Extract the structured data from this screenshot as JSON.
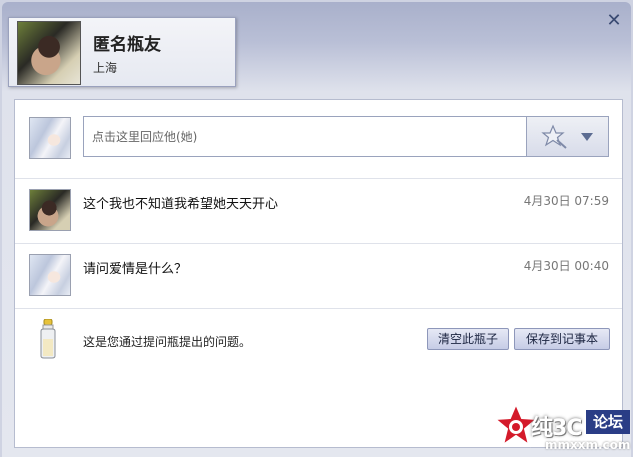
{
  "header": {
    "name": "匿名瓶友",
    "location": "上海",
    "close_icon": "✕"
  },
  "reply": {
    "placeholder": "点击这里回应他(她)",
    "emoji_icon": "magic-star-icon",
    "dropdown_icon": "caret-down-icon"
  },
  "messages": [
    {
      "text": "这个我也不知道我希望她天天开心",
      "time": "4月30日 07:59",
      "avatar": "photo"
    },
    {
      "text": "请问爱情是什么？",
      "time": "4月30日 00:40",
      "avatar": "anime"
    }
  ],
  "footer": {
    "note": "这是您通过提问瓶提出的问题。",
    "clear_button": "清空此瓶子",
    "save_button": "保存到记事本"
  },
  "watermark": {
    "text": "纯3C",
    "badge": "论坛",
    "url": "mmxxm.com"
  },
  "colors": {
    "accent": "#3a4a72",
    "button_bg": "#c6cce6",
    "time_text": "#777777"
  }
}
